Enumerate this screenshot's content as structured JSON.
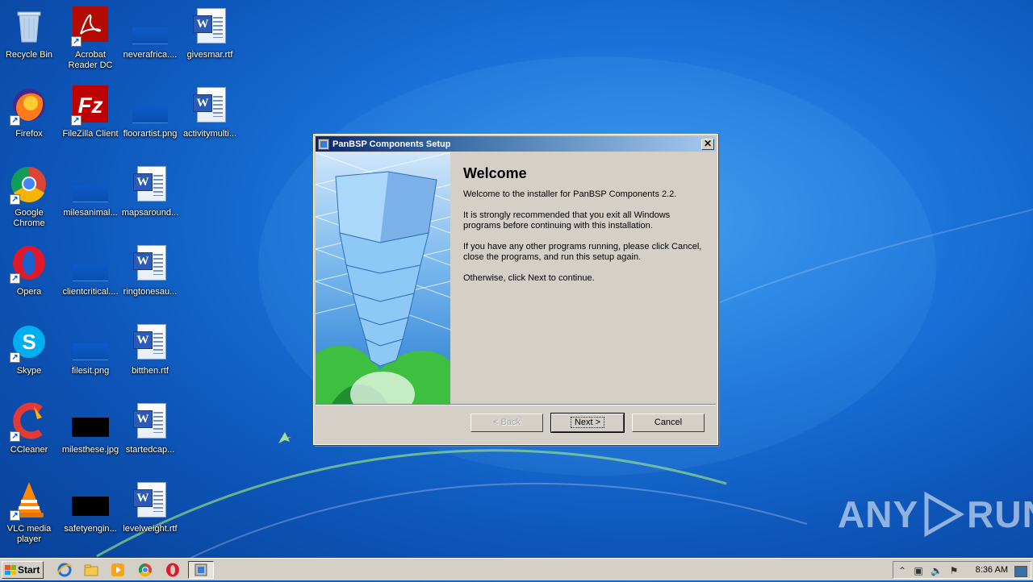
{
  "desktop": {
    "icons": [
      {
        "label": "Recycle Bin"
      },
      {
        "label": "Acrobat Reader DC"
      },
      {
        "label": "neverafrica...."
      },
      {
        "label": "givesmar.rtf"
      },
      {
        "label": "Firefox"
      },
      {
        "label": "FileZilla Client"
      },
      {
        "label": "floorartist.png"
      },
      {
        "label": "activitymulti..."
      },
      {
        "label": "Google Chrome"
      },
      {
        "label": "milesanimal..."
      },
      {
        "label": "mapsaround..."
      },
      {
        "label": "Opera"
      },
      {
        "label": "clientcritical...."
      },
      {
        "label": "ringtonesau..."
      },
      {
        "label": "Skype"
      },
      {
        "label": "filesit.png"
      },
      {
        "label": "bitthen.rtf"
      },
      {
        "label": "CCleaner"
      },
      {
        "label": "milesthese.jpg"
      },
      {
        "label": "startedcap..."
      },
      {
        "label": "VLC media player"
      },
      {
        "label": "safetyengin..."
      },
      {
        "label": "levelweight.rtf"
      }
    ]
  },
  "dialog": {
    "title": "PanBSP Components Setup",
    "close_glyph": "✕",
    "heading": "Welcome",
    "paragraphs": [
      "Welcome to the installer for PanBSP Components 2.2.",
      "It is strongly recommended that you exit all Windows programs before continuing with this installation.",
      "If you have any other programs running, please click Cancel, close the programs, and run this setup again.",
      "Otherwise, click Next to continue."
    ],
    "buttons": {
      "back": "< Back",
      "next": "Next >",
      "cancel": "Cancel"
    }
  },
  "taskbar": {
    "start_label": "Start",
    "clock": "8:36 AM"
  },
  "watermark": {
    "left": "ANY",
    "right": "RUN"
  },
  "colors": {
    "title_gradient_start": "#0a246a",
    "dialog_face": "#d4d0c8",
    "desktop": "#1a72d8"
  }
}
